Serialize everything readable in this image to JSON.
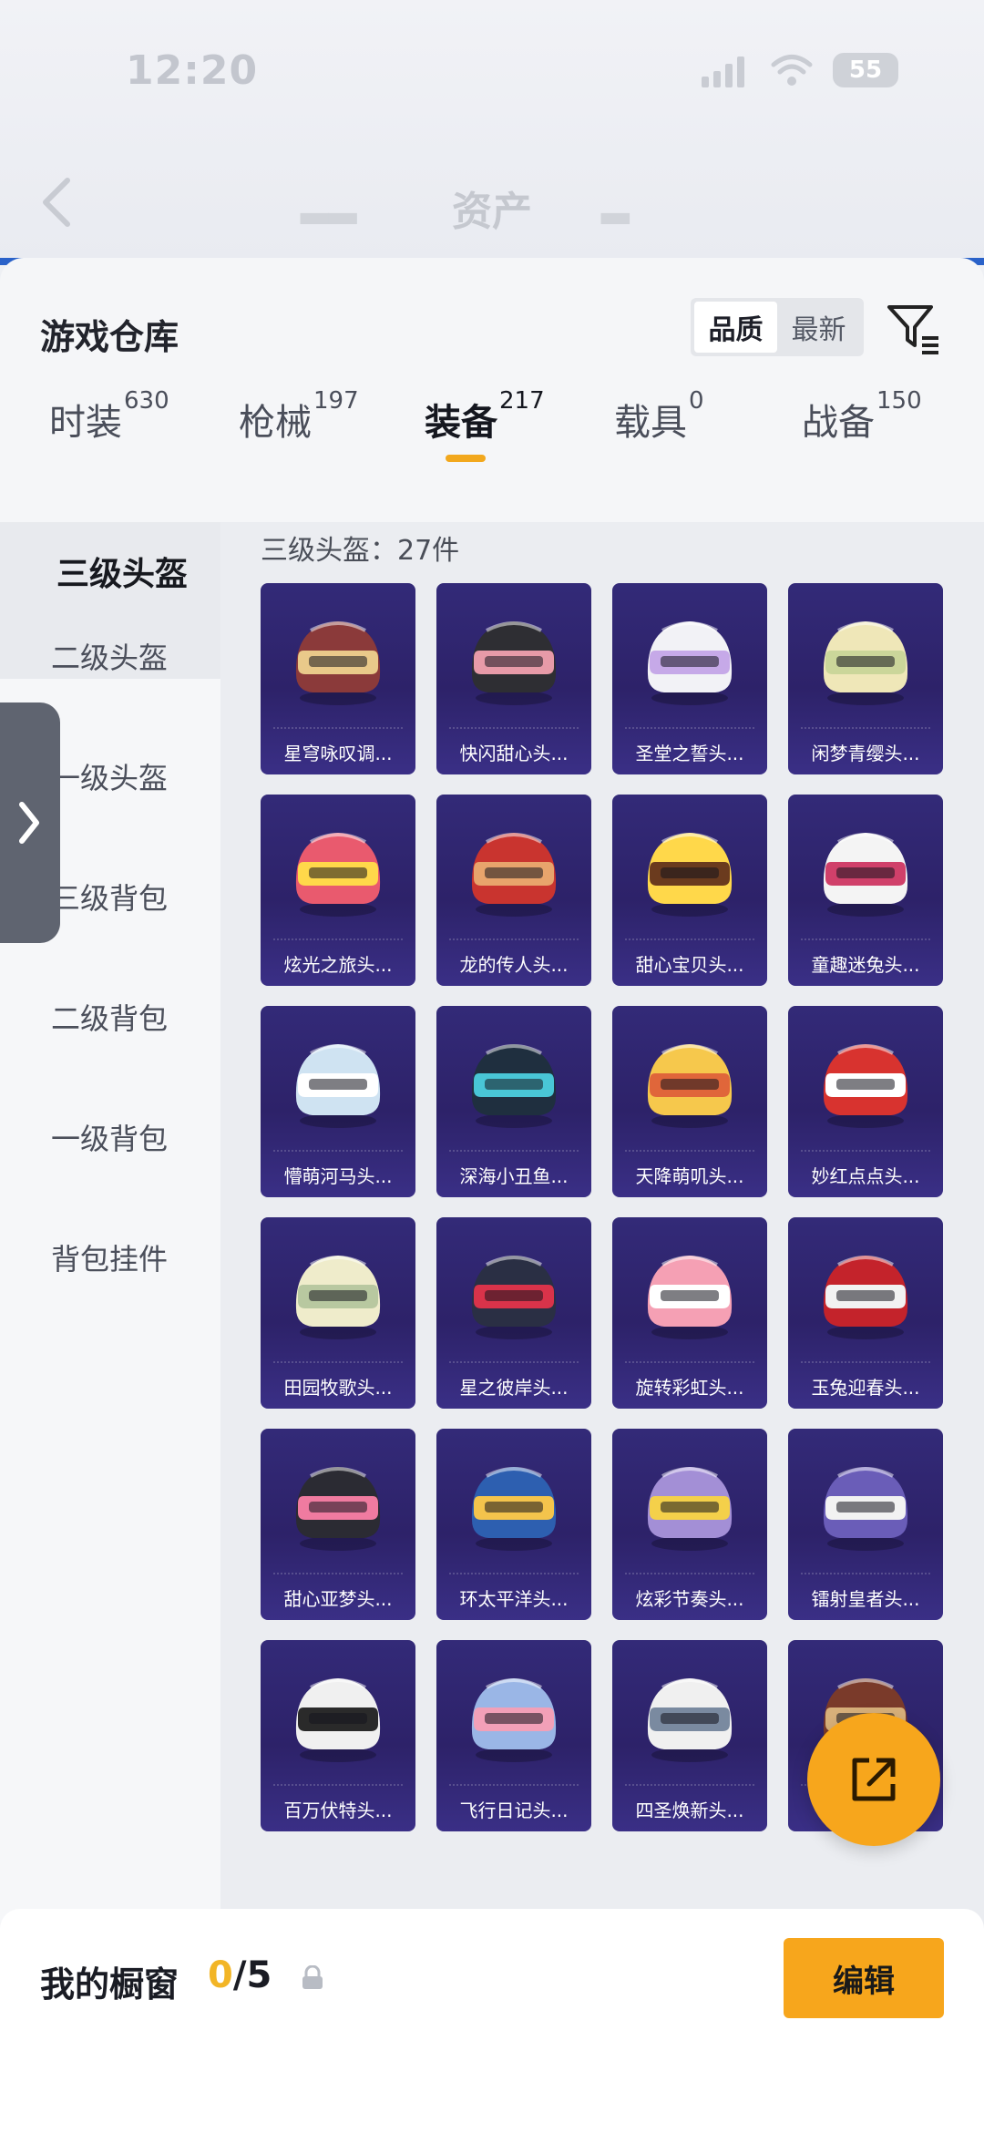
{
  "status": {
    "time": "12:20",
    "battery": "55"
  },
  "nav": {
    "title": "资产"
  },
  "warehouse": {
    "title": "游戏仓库",
    "sort": [
      "品质",
      "最新"
    ]
  },
  "tabs": [
    {
      "label": "时装",
      "count": "630"
    },
    {
      "label": "枪械",
      "count": "197"
    },
    {
      "label": "装备",
      "count": "217"
    },
    {
      "label": "载具",
      "count": "0"
    },
    {
      "label": "战备",
      "count": "150"
    }
  ],
  "categories": [
    "三级头盔",
    "二级头盔",
    "一级头盔",
    "三级背包",
    "二级背包",
    "一级背包",
    "背包挂件"
  ],
  "count_label": "三级头盔：27件",
  "items": [
    "星穹咏叹调...",
    "快闪甜心头...",
    "圣堂之誓头...",
    "闲梦青缨头...",
    "炫光之旅头...",
    "龙的传人头...",
    "甜心宝贝头...",
    "童趣迷兔头...",
    "懵萌河马头...",
    "深海小丑鱼...",
    "天降萌叽头...",
    "妙红点点头...",
    "田园牧歌头...",
    "星之彼岸头...",
    "旋转彩虹头...",
    "玉兔迎春头...",
    "甜心亚梦头...",
    "环太平洋头...",
    "炫彩节奏头...",
    "镭射皇者头...",
    "百万伏特头...",
    "飞行日记头...",
    "四圣焕新头...",
    ""
  ],
  "item_colors": [
    [
      "#8b3a3a",
      "#e9c98a"
    ],
    [
      "#2e2e33",
      "#e79aa8"
    ],
    [
      "#f2f2f6",
      "#c6a9e8"
    ],
    [
      "#efe7b8",
      "#cbd69a"
    ],
    [
      "#e95a6e",
      "#ffd84a"
    ],
    [
      "#c9342f",
      "#e8a46c"
    ],
    [
      "#ffd84a",
      "#6b3b1e"
    ],
    [
      "#f4f4f4",
      "#d0406a"
    ],
    [
      "#cfe3f2",
      "#ffffff"
    ],
    [
      "#1f2f3f",
      "#49c6d6"
    ],
    [
      "#f6c84c",
      "#e0663a"
    ],
    [
      "#d8332f",
      "#ffffff"
    ],
    [
      "#efeccb",
      "#b8c8a0"
    ],
    [
      "#2a2f44",
      "#d9334a"
    ],
    [
      "#f5a0b4",
      "#ffffff"
    ],
    [
      "#c4232b",
      "#f2f2f2"
    ],
    [
      "#2b2b33",
      "#f07ba0"
    ],
    [
      "#2d5fb0",
      "#f4c44c"
    ],
    [
      "#a38fd6",
      "#f4d04a"
    ],
    [
      "#6a5db8",
      "#f2f2f2"
    ],
    [
      "#f0f0f0",
      "#2a2a2a"
    ],
    [
      "#9ab6e6",
      "#f2a0b8"
    ],
    [
      "#f0f0f0",
      "#7a8aa0"
    ],
    [
      "#7a3a2a",
      "#d8b07a"
    ]
  ],
  "showcase": {
    "title": "我的橱窗",
    "used": "0",
    "total": "/5",
    "edit": "编辑"
  }
}
